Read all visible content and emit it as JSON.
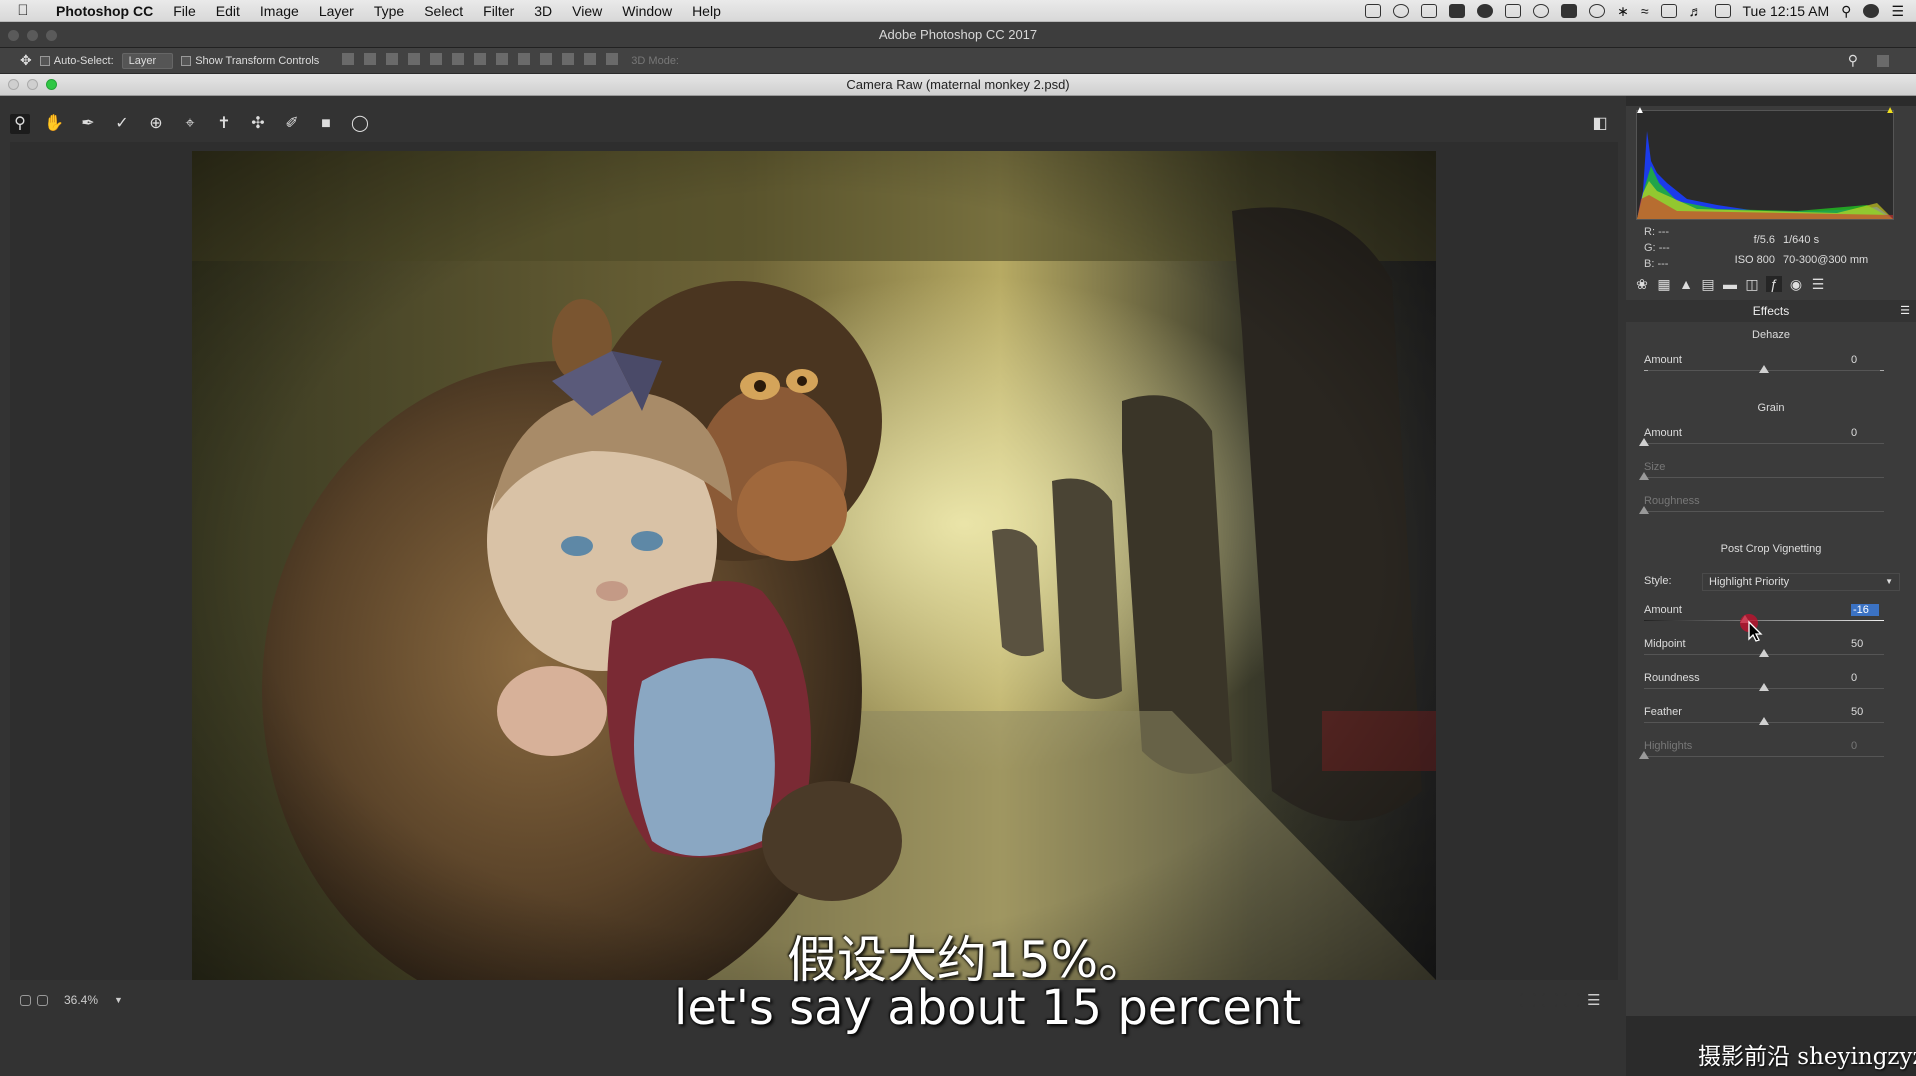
{
  "menubar": {
    "app_name": "Photoshop CC",
    "items": [
      "File",
      "Edit",
      "Image",
      "Layer",
      "Type",
      "Select",
      "Filter",
      "3D",
      "View",
      "Window",
      "Help"
    ],
    "clock": "Tue 12:15 AM"
  },
  "app_title": "Adobe Photoshop CC 2017",
  "options_bar": {
    "auto_select_label": "Auto-Select:",
    "auto_select_value": "Layer",
    "transform_label": "Show Transform Controls",
    "mode_3d_label": "3D Mode:"
  },
  "camera_raw": {
    "title": "Camera Raw (maternal monkey 2.psd)",
    "zoom": "36.4%"
  },
  "panel": {
    "rgb": {
      "r_label": "R:",
      "r": "---",
      "g_label": "G:",
      "g": "---",
      "b_label": "B:",
      "b": "---"
    },
    "meta": {
      "aperture": "f/5.6",
      "shutter": "1/640 s",
      "iso": "ISO 800",
      "lens": "70-300@300 mm"
    },
    "header": "Effects",
    "dehaze": {
      "title": "Dehaze",
      "amount_label": "Amount",
      "amount": "0",
      "amount_level": 0.5
    },
    "grain": {
      "title": "Grain",
      "amount_label": "Amount",
      "amount": "0",
      "amount_level": 0,
      "size_label": "Size",
      "size_level": 0,
      "roughness_label": "Roughness",
      "roughness_level": 0
    },
    "vignette": {
      "title": "Post Crop Vignetting",
      "style_label": "Style:",
      "style_value": "Highlight Priority",
      "amount_label": "Amount",
      "amount": "-16",
      "amount_level": 0.42,
      "midpoint_label": "Midpoint",
      "midpoint": "50",
      "midpoint_level": 0.5,
      "roundness_label": "Roundness",
      "roundness": "0",
      "roundness_level": 0.5,
      "feather_label": "Feather",
      "feather": "50",
      "feather_level": 0.5,
      "highlights_label": "Highlights",
      "highlights": "0",
      "highlights_level": 0
    }
  },
  "subtitle_cn": "假设大约15%。",
  "subtitle_en": "let's say about 15 percent",
  "watermark": "摄影前沿 sheyingzyz.com"
}
